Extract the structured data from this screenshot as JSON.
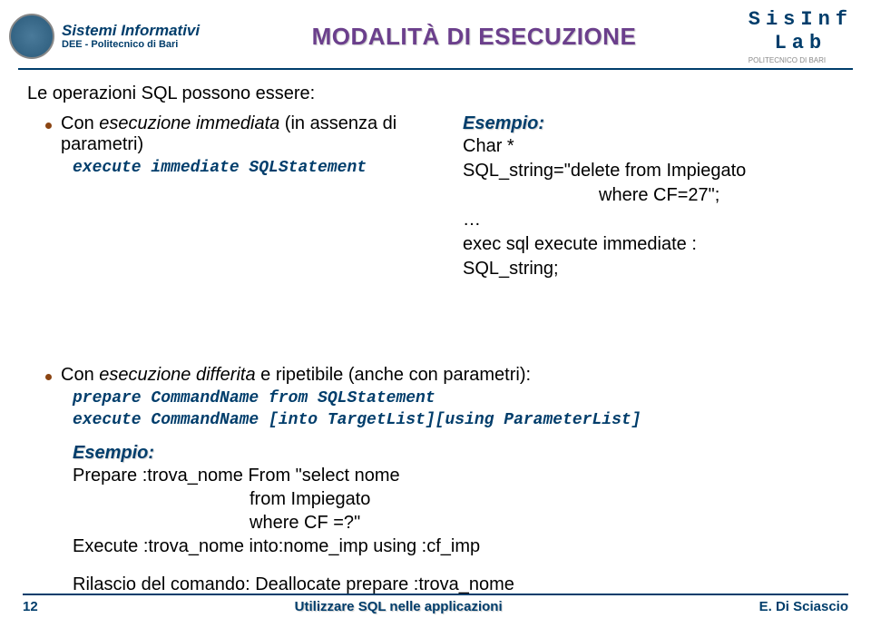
{
  "header": {
    "uni_title": "Sistemi Informativi",
    "uni_sub": "DEE - Politecnico di Bari",
    "main_title": "MODALITÀ DI ESECUZIONE",
    "sisinf": "SisInf",
    "lab": "Lab",
    "poli": "POLITECNICO DI BARI"
  },
  "content": {
    "intro": "Le operazioni SQL possono essere:",
    "bullet1_pre": "Con ",
    "bullet1_em": "esecuzione immediata",
    "bullet1_post": " (in assenza di parametri)",
    "code1": "execute immediate SQLStatement",
    "example_label": "Esempio:",
    "ex1_line1": "Char *",
    "ex1_line2a": "SQL_string=",
    "ex1_line2b": "delete from Impiegato",
    "ex1_line3": "where CF=27",
    "ex1_line3b": ";",
    "ex1_line4": "…",
    "ex1_line5": "exec sql execute immediate :",
    "ex1_line6": "SQL_string;",
    "bullet2_pre": "Con ",
    "bullet2_em": "esecuzione differita",
    "bullet2_post": " e ripetibile (anche con parametri):",
    "code2": "prepare CommandName from SQLStatement",
    "code3": "execute CommandName [into TargetList][using ParameterList]",
    "ex2_line1a": "Prepare :trova_nome From ",
    "ex2_line1b": "select nome",
    "ex2_line2": "from Impiegato",
    "ex2_line3": "where CF =?",
    "ex2_line4": "Execute :trova_nome into:nome_imp using :cf_imp",
    "release": "Rilascio del comando: Deallocate prepare :trova_nome"
  },
  "footer": {
    "page": "12",
    "mid": "Utilizzare SQL nelle applicazioni",
    "author": "E. Di Sciascio"
  }
}
